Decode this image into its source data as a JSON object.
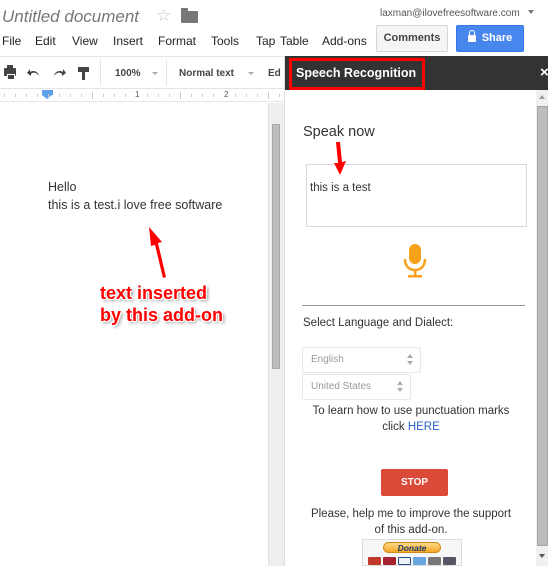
{
  "header": {
    "doc_title": "Untitled document",
    "star_icon": "star-outline-icon",
    "folder_icon": "folder-icon",
    "account_email": "laxman@ilovefreesoftware.com",
    "menu": [
      "File",
      "Edit",
      "View",
      "Insert",
      "Format",
      "Tools",
      "Tap",
      "Table",
      "Add-ons"
    ],
    "comments_label": "Comments",
    "share_label": "Share"
  },
  "toolbar": {
    "zoom": "100%",
    "style": "Normal text",
    "font_partial": "Ed"
  },
  "ruler": {
    "labels": [
      "1",
      "2"
    ]
  },
  "document": {
    "lines": [
      "Hello",
      "this is a test.i love free software"
    ]
  },
  "annotation": {
    "line1": "text inserted",
    "line2": "by this add-on",
    "color": "#ff0000"
  },
  "sidebar": {
    "title": "Speech Recognition",
    "close_label": "×",
    "speak_now": "Speak now",
    "transcript": "this is a test",
    "mic_icon": "microphone-icon",
    "mic_color": "#f9a11b",
    "language_label": "Select Language and Dialect:",
    "language_select": "English",
    "dialect_select": "United States",
    "punctuation_text": "To learn how to use punctuation marks",
    "punctuation_click": "click",
    "punctuation_link": "HERE",
    "stop_label": "STOP",
    "stop_color": "#db4a39",
    "support_line1": "Please, help me to improve the support",
    "support_line2": "of this add-on.",
    "donate_label": "Donate"
  },
  "colors": {
    "share_blue": "#4787ed",
    "sidebar_header": "#333333",
    "highlight_red": "#ff0000",
    "link_blue": "#2a62c9"
  }
}
